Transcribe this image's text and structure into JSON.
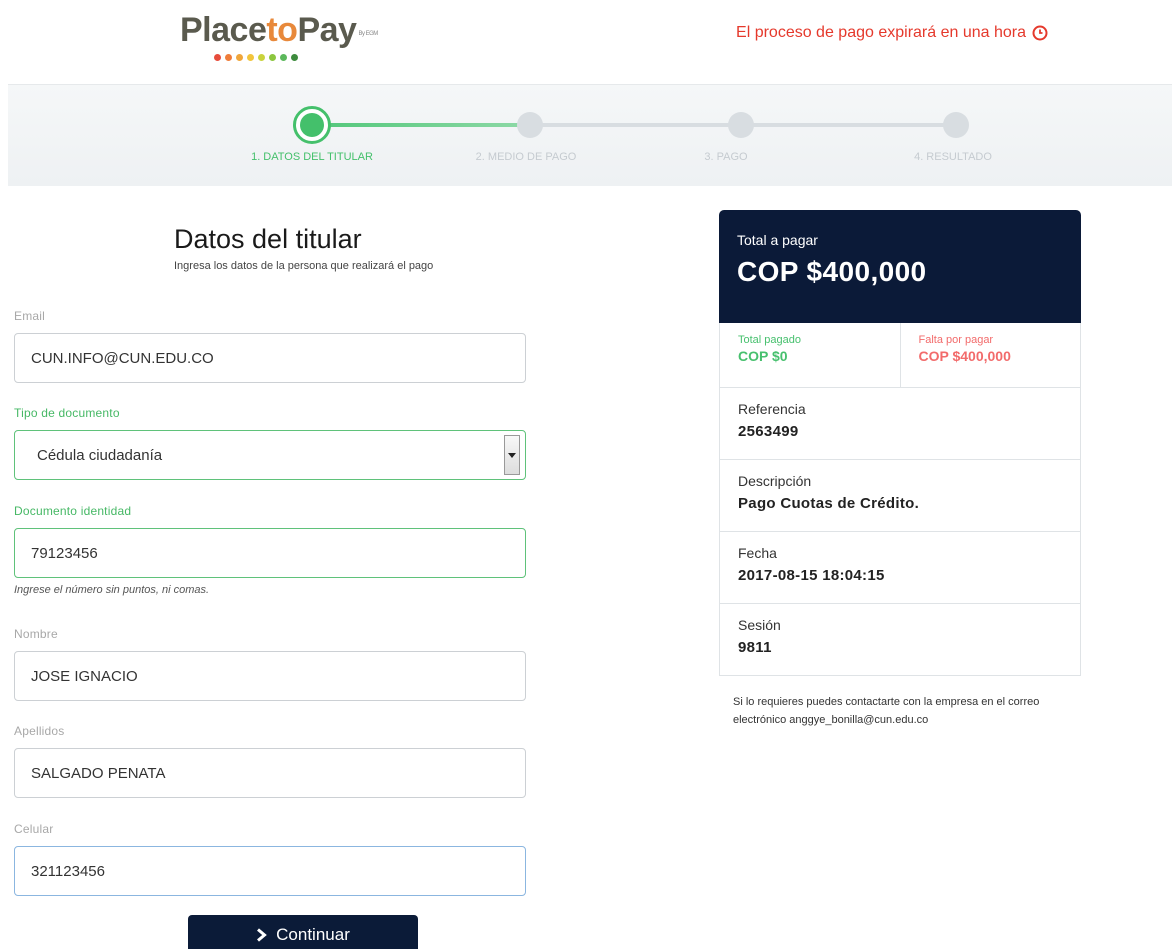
{
  "header": {
    "logo": {
      "place": "Place",
      "to": "to",
      "pay": "Pay",
      "by": "By EGM"
    },
    "logo_dot_colors": [
      "#e74c3c",
      "#ef7d3a",
      "#f0a63b",
      "#f2c53d",
      "#c9d33d",
      "#8cc63f",
      "#5cb85c",
      "#3d8b3d"
    ],
    "expiry_text": "El proceso de pago expirará en una hora",
    "expiry_icon": "clock-icon",
    "expiry_color": "#e5392c"
  },
  "steps": {
    "items": [
      {
        "label": "1. DATOS DEL TITULAR",
        "active": true
      },
      {
        "label": "2. MEDIO DE PAGO",
        "active": false
      },
      {
        "label": "3. PAGO",
        "active": false
      },
      {
        "label": "4. RESULTADO",
        "active": false
      }
    ],
    "active_color": "#44c06b"
  },
  "form": {
    "title": "Datos del titular",
    "subtitle": "Ingresa los datos de la persona que realizará el pago",
    "email": {
      "label": "Email",
      "value": "CUN.INFO@CUN.EDU.CO"
    },
    "doc_type": {
      "label": "Tipo de documento",
      "value": "Cédula ciudadanía"
    },
    "doc_id": {
      "label": "Documento identidad",
      "value": "79123456",
      "help": "Ingrese el número sin puntos, ni comas."
    },
    "first_name": {
      "label": "Nombre",
      "value": "JOSE IGNACIO"
    },
    "last_name": {
      "label": "Apellidos",
      "value": "SALGADO PENATA"
    },
    "phone": {
      "label": "Celular",
      "value": "321123456"
    },
    "submit_label": "Continuar",
    "submit_icon": "chevron-right-icon"
  },
  "summary": {
    "total_label": "Total a pagar",
    "total_amount": "COP $400,000",
    "paid_label": "Total pagado",
    "paid_amount": "COP $0",
    "due_label": "Falta por pagar",
    "due_amount": "COP $400,000",
    "reference_label": "Referencia",
    "reference_value": "2563499",
    "description_label": "Descripción",
    "description_value": "Pago Cuotas de Crédito.",
    "date_label": "Fecha",
    "date_value": "2017-08-15 18:04:15",
    "session_label": "Sesión",
    "session_value": "9811",
    "contact_text": "Si lo requieres puedes contactarte con la empresa en el correo electrónico anggye_bonilla@cun.edu.co",
    "header_color": "#0b1a38"
  }
}
